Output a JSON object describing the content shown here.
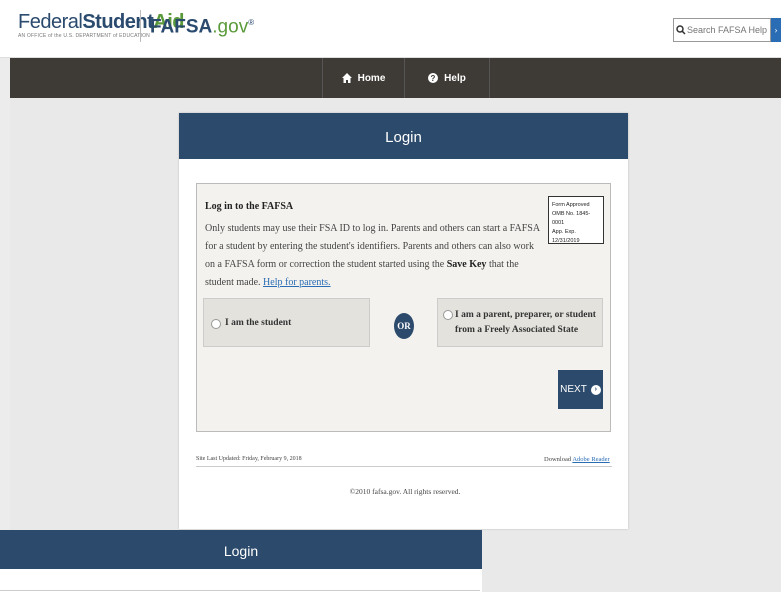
{
  "brand": {
    "logo_part1": "Federal",
    "logo_part2": "Student",
    "logo_part3": "Aid",
    "logo_sub": "AN OFFICE of the U.S. DEPARTMENT of EDUCATION",
    "site_name": "FAFSA",
    "site_tld": ".gov",
    "site_mark": "®"
  },
  "search": {
    "placeholder": "Search FAFSA Help",
    "button": "›"
  },
  "nav": {
    "home": "Home",
    "help": "Help"
  },
  "login": {
    "header": "Login",
    "title": "Log in to the FAFSA",
    "body_1": "Only students may use their FSA ID to log in. Parents and others can start a FAFSA for a student by entering the student's identifiers. Parents and others can also work on a FAFSA form or correction the student started using the ",
    "body_bold": "Save Key",
    "body_2": " that the student made. ",
    "help_link": "Help for parents.",
    "omb_line1": "Form Approved",
    "omb_line2": "OMB No. 1845-0001",
    "omb_line3": "App. Exp. 12/31/2019",
    "choice_student": "I am the student",
    "or_label": "OR",
    "choice_parent": "I am a parent, preparer, or student from a Freely Associated State",
    "next_label": "NEXT",
    "next_icon": "›"
  },
  "footer": {
    "updated": "Site Last Updated: Friday, February 9, 2018",
    "download_prefix": "Download ",
    "download_link": "Adobe Reader",
    "copyright": "©2010 fafsa.gov. All rights reserved."
  },
  "duplicate": {
    "header": "Login"
  },
  "colors": {
    "header_navy": "#2c4a6b",
    "nav_dark": "#3e3a35",
    "link_blue": "#2a6db5",
    "brand_green": "#5a9a3a"
  }
}
